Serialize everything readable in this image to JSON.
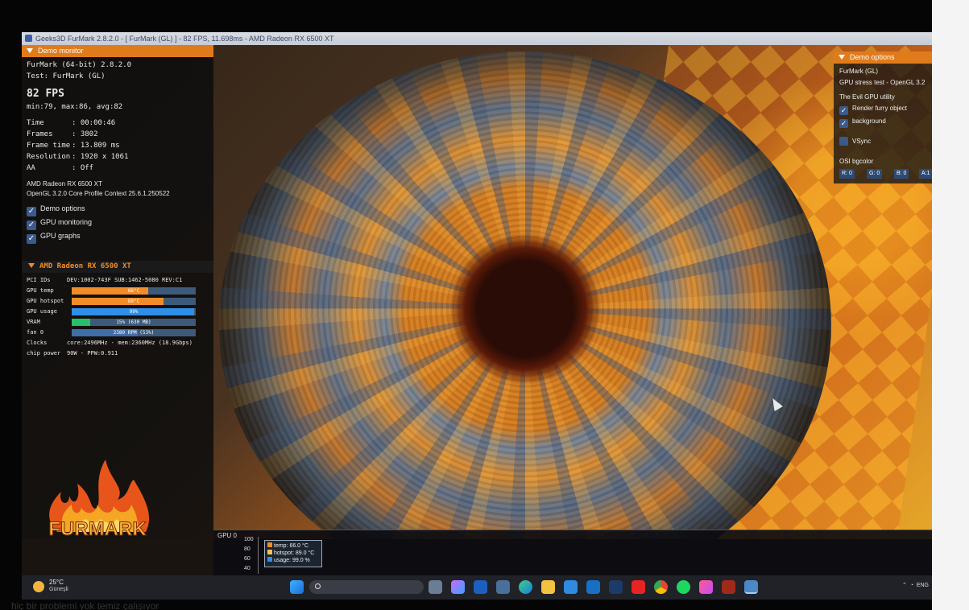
{
  "window": {
    "title": "Geeks3D FurMark 2.8.2.0 - [ FurMark (GL) ] - 82 FPS, 11.698ms - AMD Radeon RX 6500 XT"
  },
  "demo_monitor": {
    "header": "Demo monitor",
    "app_line": "FurMark (64-bit) 2.8.2.0",
    "test_line": "Test: FurMark (GL)",
    "fps": "82 FPS",
    "fps_stats": "min:79, max:86, avg:82",
    "stats": [
      {
        "key": "Time",
        "value": ": 00:00:46"
      },
      {
        "key": "Frames",
        "value": ": 3802"
      },
      {
        "key": "Frame time",
        "value": ": 13.809 ms"
      },
      {
        "key": "Resolution",
        "value": ": 1920 x 1061"
      },
      {
        "key": "AA",
        "value": ": Off"
      }
    ],
    "gpu_name": "AMD Radeon RX 6500 XT",
    "gl_context": "OpenGL 3.2.0 Core Profile Context 25.6.1.250522",
    "checkboxes": [
      {
        "label": "Demo options",
        "checked": true
      },
      {
        "label": "GPU monitoring",
        "checked": true
      },
      {
        "label": "GPU graphs",
        "checked": true
      }
    ]
  },
  "gpu_monitor": {
    "header": "AMD Radeon RX 6500 XT",
    "pci_label": "PCI IDs",
    "pci_value": "DEV:1002-743F SUB:1462-5080 REV:C1",
    "rows": [
      {
        "label": "GPU temp",
        "text": "66°C",
        "fraction": 0.62,
        "color": "#f28c28"
      },
      {
        "label": "GPU hotspot",
        "text": "89°C",
        "fraction": 0.74,
        "color": "#f28c28"
      },
      {
        "label": "GPU usage",
        "text": "99%",
        "fraction": 0.99,
        "color": "#2f8ee8"
      },
      {
        "label": "VRAM",
        "text": "15% (630 MB)",
        "fraction": 0.15,
        "color": "#27c06a"
      },
      {
        "label": "fan 0",
        "text": "2380 RPM (53%)",
        "fraction": 0.53,
        "color": "#3f6ea8"
      }
    ],
    "clocks_label": "Clocks",
    "clocks_value": "core:2496MHz - mem:2360MHz (18.9Gbps)",
    "power_label": "chip power",
    "power_value": "90W - PPW:0.911"
  },
  "logo_text": "FURMARK",
  "demo_options": {
    "header": "Demo options",
    "title": "FurMark (GL)",
    "subtitle": "GPU stress test - OpenGL 3.2",
    "utility": "The Evil GPU utility",
    "checkboxes": [
      {
        "label": "Render furry object",
        "checked": true
      },
      {
        "label": "background",
        "checked": true
      },
      {
        "label": "VSync",
        "checked": false
      }
    ],
    "bgcolor_label": "OSI bgcolor",
    "bgcolor_fields": [
      "R: 0",
      "G: 0",
      "B: 0",
      "A:1"
    ]
  },
  "gpu_graph": {
    "title": "GPU 0",
    "y_ticks": [
      "100",
      "80",
      "60",
      "40"
    ],
    "legend": [
      {
        "label": "temp: 66.0 °C",
        "color": "#f28c28"
      },
      {
        "label": "hotspot: 89.0 °C",
        "color": "#f5c542"
      },
      {
        "label": "usage: 99.0 %",
        "color": "#2f8ee8"
      }
    ]
  },
  "taskbar": {
    "temperature": "25°C",
    "condition": "Güneşli",
    "tray_text": "ENG",
    "apps": [
      "start",
      "search",
      "task-view",
      "copilot",
      "xbox",
      "calculator",
      "edge",
      "file-explorer",
      "store",
      "outlook",
      "steam",
      "youtube",
      "chrome",
      "spotify",
      "itunes",
      "furmark-app",
      "active-window"
    ]
  },
  "caption": "hiç bir problemi yok temiz çalışıyor"
}
